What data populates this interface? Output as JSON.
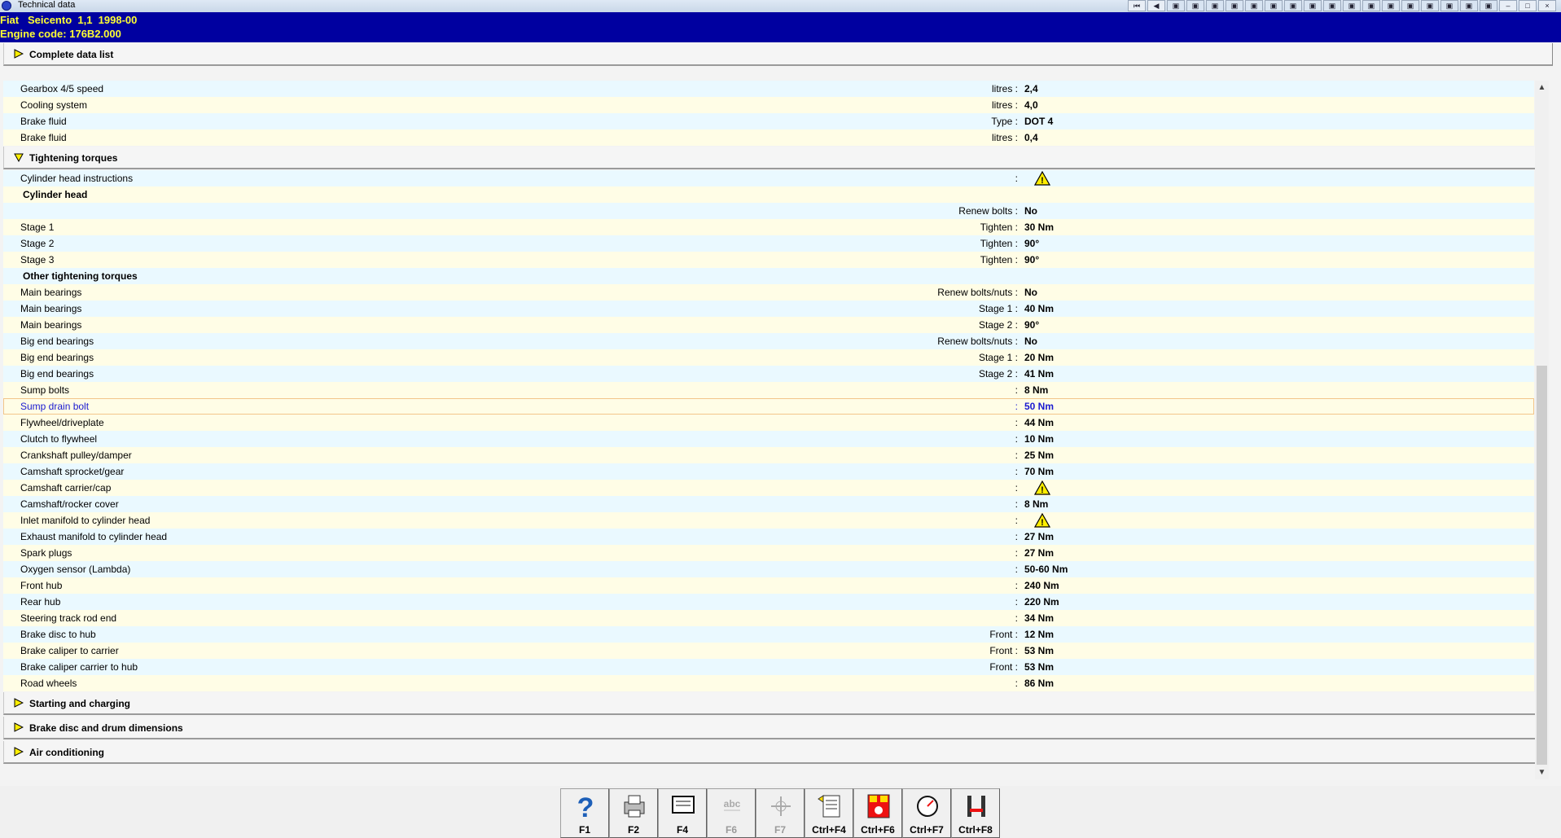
{
  "window": {
    "title": "Technical data",
    "toolbar_icons": [
      "first-icon",
      "prev-icon",
      "tool-icon",
      "tool-icon",
      "tool-icon",
      "tool-icon",
      "tool-icon",
      "tool-icon",
      "tool-icon",
      "tool-icon",
      "tool-icon",
      "tool-icon",
      "tool-icon",
      "tool-icon",
      "tool-icon",
      "tool-icon",
      "tool-icon",
      "tool-icon",
      "tool-icon",
      "minimize-icon",
      "maximize-icon",
      "close-icon"
    ]
  },
  "vehicle": {
    "line1": "Fiat   Seicento  1,1  1998-00",
    "line2": "Engine code: 176B2.000"
  },
  "sections": {
    "complete": "Complete data list",
    "tightening": "Tightening torques",
    "starting": "Starting and charging",
    "brake_disc": "Brake disc and drum dimensions",
    "aircon": "Air conditioning"
  },
  "rows": [
    {
      "name": "Gearbox 4/5 speed",
      "qual": "litres :",
      "val": "2,4"
    },
    {
      "name": "Cooling system",
      "qual": "litres :",
      "val": "4,0"
    },
    {
      "name": "Brake fluid",
      "qual": "Type :",
      "val": "DOT 4"
    },
    {
      "name": "Brake fluid",
      "qual": "litres :",
      "val": "0,4"
    }
  ],
  "torques": [
    {
      "name": "Cylinder head instructions",
      "qual": ":",
      "val": "",
      "warn": true
    },
    {
      "name": "Cylinder head",
      "qual": "",
      "val": "",
      "subhead": true
    },
    {
      "name": "",
      "qual": "Renew bolts :",
      "val": "No"
    },
    {
      "name": "Stage 1",
      "qual": "Tighten :",
      "val": "30 Nm"
    },
    {
      "name": "Stage 2",
      "qual": "Tighten :",
      "val": "90°"
    },
    {
      "name": "Stage 3",
      "qual": "Tighten :",
      "val": "90°"
    },
    {
      "name": "Other tightening torques",
      "qual": "",
      "val": "",
      "subhead": true
    },
    {
      "name": "Main bearings",
      "qual": "Renew bolts/nuts :",
      "val": "No"
    },
    {
      "name": "Main bearings",
      "qual": "Stage 1 :",
      "val": "40 Nm"
    },
    {
      "name": "Main bearings",
      "qual": "Stage 2 :",
      "val": "90°"
    },
    {
      "name": "Big end bearings",
      "qual": "Renew bolts/nuts :",
      "val": "No"
    },
    {
      "name": "Big end bearings",
      "qual": "Stage 1 :",
      "val": "20 Nm"
    },
    {
      "name": "Big end bearings",
      "qual": "Stage 2 :",
      "val": "41 Nm"
    },
    {
      "name": "Sump bolts",
      "qual": ":",
      "val": "8 Nm"
    },
    {
      "name": "Sump drain bolt",
      "qual": ":",
      "val": "50 Nm",
      "selected": true
    },
    {
      "name": "Flywheel/driveplate",
      "qual": ":",
      "val": "44 Nm"
    },
    {
      "name": "Clutch to flywheel",
      "qual": ":",
      "val": "10 Nm"
    },
    {
      "name": "Crankshaft pulley/damper",
      "qual": ":",
      "val": "25 Nm"
    },
    {
      "name": "Camshaft sprocket/gear",
      "qual": ":",
      "val": "70 Nm"
    },
    {
      "name": "Camshaft carrier/cap",
      "qual": ":",
      "val": "",
      "warn": true
    },
    {
      "name": "Camshaft/rocker cover",
      "qual": ":",
      "val": "8 Nm"
    },
    {
      "name": "Inlet manifold to cylinder head",
      "qual": ":",
      "val": "",
      "warn": true
    },
    {
      "name": "Exhaust manifold to cylinder head",
      "qual": ":",
      "val": "27 Nm"
    },
    {
      "name": "Spark plugs",
      "qual": ":",
      "val": "27 Nm"
    },
    {
      "name": "Oxygen sensor (Lambda)",
      "qual": ":",
      "val": "50-60 Nm"
    },
    {
      "name": "Front hub",
      "qual": ":",
      "val": "240 Nm"
    },
    {
      "name": "Rear hub",
      "qual": ":",
      "val": "220 Nm"
    },
    {
      "name": "Steering track rod end",
      "qual": ":",
      "val": "34 Nm"
    },
    {
      "name": "Brake disc to hub",
      "qual": "Front :",
      "val": "12 Nm"
    },
    {
      "name": "Brake caliper to carrier",
      "qual": "Front :",
      "val": "53 Nm"
    },
    {
      "name": "Brake caliper carrier to hub",
      "qual": "Front :",
      "val": "53 Nm"
    },
    {
      "name": "Road wheels",
      "qual": ":",
      "val": "86 Nm"
    }
  ],
  "fkeys": [
    {
      "label": "F1",
      "icon": "help-icon",
      "disabled": false
    },
    {
      "label": "F2",
      "icon": "printer-icon",
      "disabled": false
    },
    {
      "label": "F4",
      "icon": "screen-icon",
      "disabled": false
    },
    {
      "label": "F6",
      "icon": "text-icon",
      "disabled": true
    },
    {
      "label": "F7",
      "icon": "crosshair-icon",
      "disabled": true
    },
    {
      "label": "Ctrl+F4",
      "icon": "notes-icon",
      "disabled": false
    },
    {
      "label": "Ctrl+F6",
      "icon": "sequence-icon",
      "disabled": false
    },
    {
      "label": "Ctrl+F7",
      "icon": "gauge-icon",
      "disabled": false
    },
    {
      "label": "Ctrl+F8",
      "icon": "lift-icon",
      "disabled": false
    }
  ]
}
